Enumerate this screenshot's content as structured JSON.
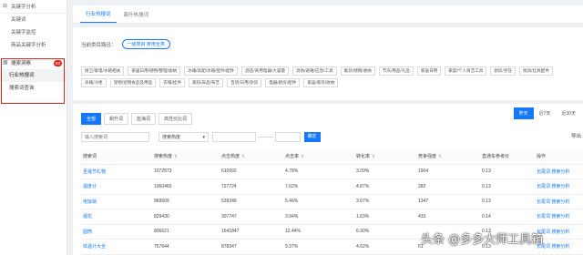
{
  "sidebar": {
    "groups": [
      {
        "label": "关键字分析"
      },
      {
        "label": "搜索洞察",
        "badge": "83"
      }
    ],
    "keyword_items": [
      "关键词",
      "关键字监控",
      "商品关键字分析"
    ],
    "insight_items": [
      "行业热搜词",
      "搜索词查询"
    ]
  },
  "top_tabs": [
    "行业热搜词",
    "飙升热搜词"
  ],
  "filter": {
    "label": "当前类目路径：",
    "selected": "一级类目 家用全类",
    "tags": [
      "厨卫/家电/冰箱相关",
      "家居日用/储物/整理/收纳",
      "冰箱/高配/冰箱/配件/配件",
      "酒店/商用电器/大容量",
      "消防/避难/应急/工具",
      "集装/储物/收纳",
      "节庆/用品/礼品",
      "家居日用",
      "家庭/个人清洁工具",
      "厨房/烹饪",
      "厨具/灶具配件",
      "冰箱/冷柜",
      "宠物/宠物食品及用品",
      "衣帽/挂件",
      "家纺/床品/布艺",
      "百货/日用/杂货",
      "电器/厨房/配件",
      "家居/家装/收纳"
    ]
  },
  "sub_tabs": [
    "全部",
    "飙升词",
    "蓝海词",
    "高性价比词"
  ],
  "date_buttons": [
    "昨天",
    "近7天",
    "近30天"
  ],
  "search": {
    "placeholder": "输入搜索词",
    "sort_value": "搜索热度",
    "confirm": "确定",
    "export": "导出"
  },
  "table": {
    "headers": [
      "搜索词",
      "搜索热度",
      "点击热度",
      "点击率",
      "转化率",
      "竞争强度",
      "直通车参考价",
      "操作"
    ],
    "rows": [
      {
        "kw": "圣诞节礼物",
        "hot": "1072873",
        "click": "610992",
        "ctr": "4.78%",
        "cvr": "3.09%",
        "comp": "1904",
        "cpc": "0.13",
        "op": "长尾词 搜索分析"
      },
      {
        "kw": "温度计",
        "hot": "1060460",
        "click": "727724",
        "ctr": "7.62%",
        "cvr": "4.87%",
        "comp": "282",
        "cpc": "0.13",
        "op": "长尾词 搜索分析"
      },
      {
        "kw": "电饭锅",
        "hot": "969509",
        "click": "539346",
        "ctr": "5.46%",
        "cvr": "3.67%",
        "comp": "1347",
        "cpc": "0.13",
        "op": "长尾词 搜索分析"
      },
      {
        "kw": "烟花",
        "hot": "829430",
        "click": "307747",
        "ctr": "3.94%",
        "cvr": "1.63%",
        "comp": "433",
        "cpc": "0.14",
        "op": "长尾词 搜索分析"
      },
      {
        "kw": "圆筒",
        "hot": "806621",
        "click": "1641847",
        "ctr": "12.44%",
        "cvr": "6.90%",
        "comp": "",
        "cpc": "0.13",
        "op": "长尾词 搜索分析"
      },
      {
        "kw": "体温计大全",
        "hot": "757644",
        "click": "878347",
        "ctr": "9.37%",
        "cvr": "4.62%",
        "comp": "61",
        "cpc": "0.13",
        "op": "长尾词 搜索分析"
      }
    ]
  },
  "watermark": "头条 @多多大师工具箱",
  "colors": {
    "accent": "#1677ff",
    "highlight": "#e2231a"
  }
}
